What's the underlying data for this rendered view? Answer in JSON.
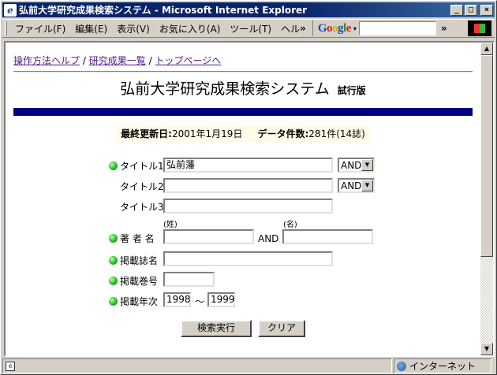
{
  "window": {
    "title": "弘前大学研究成果検索システム - Microsoft Internet Explorer",
    "app_icon": "ie-icon",
    "controls": {
      "minimize": "_",
      "maximize": "□",
      "close": "×"
    }
  },
  "menu": {
    "items": [
      "ファイル(F)",
      "編集(E)",
      "表示(V)",
      "お気に入り(A)",
      "ツール(T)",
      "ヘル"
    ],
    "overflow": "»",
    "google": {
      "logo": [
        "G",
        "o",
        "o",
        "g",
        "l",
        "e"
      ],
      "dropdown": "▾",
      "search_value": ""
    },
    "overflow2": "»"
  },
  "page": {
    "links": [
      {
        "label": "操作方法ヘルプ"
      },
      {
        "label": "研究成果一覧"
      },
      {
        "label": "トップページへ"
      }
    ],
    "separator": "/",
    "title": "弘前大学研究成果検索システム",
    "title_badge": "試行版",
    "info": {
      "updated_label": "最終更新日:",
      "updated_value": "2001年1月19日",
      "count_label": "データ件数:",
      "count_value": "281件(14誌)"
    },
    "form": {
      "title1": {
        "label": "タイトル1",
        "value": "弘前藩",
        "op": "AND"
      },
      "title2": {
        "label": "タイトル2",
        "value": "",
        "op": "AND"
      },
      "title3": {
        "label": "タイトル3",
        "value": ""
      },
      "author": {
        "label": "著 者 名",
        "sei_hint": "(姓)",
        "mei_hint": "(名)",
        "join": "AND",
        "sei": "",
        "mei": ""
      },
      "journal": {
        "label": "掲載誌名",
        "value": ""
      },
      "volume": {
        "label": "掲載巻号",
        "value": ""
      },
      "year": {
        "label": "掲載年次",
        "from": "1998",
        "sep": "～",
        "to": "1999"
      }
    },
    "buttons": {
      "search": "検索実行",
      "clear": "クリア"
    }
  },
  "status": {
    "left_icon": "page-icon",
    "zone": "インターネット",
    "zone_icon": "globe-icon"
  }
}
